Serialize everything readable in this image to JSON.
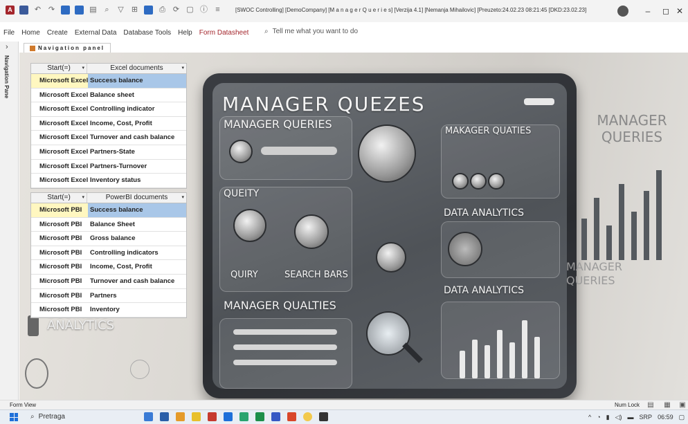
{
  "titlebar": {
    "title": "[SWOC Controlling] [DemoCompany] [M a n a g e r  Q u e r i e s] [Verzija 4.1] [Nemanja Mihailovic] [Preuzeto:24.02.23 08:21:45 [DKD:23.02.23]",
    "controls": {
      "minimize": "–",
      "restore": "◻",
      "close": "✕"
    }
  },
  "ribbon": {
    "tabs": [
      "File",
      "Home",
      "Create",
      "External Data",
      "Database Tools",
      "Help",
      "Form Datasheet"
    ],
    "active_tab": "Form Datasheet",
    "tell_me": "Tell me what you want to do"
  },
  "nav_pane": {
    "label": "Navigation Pane",
    "toggle": "›"
  },
  "document_tab": {
    "label": "Navigation panel"
  },
  "excel_list": {
    "col1_header": "Start(=)",
    "col2_header": "Excel documents",
    "rows": [
      {
        "start": "Microsoft Excel",
        "doc": "Success balance",
        "selected": true
      },
      {
        "start": "Microsoft Excel",
        "doc": "Balance sheet"
      },
      {
        "start": "Microsoft Excel",
        "doc": "Controlling indicator"
      },
      {
        "start": "Microsoft Excel",
        "doc": "Income, Cost, Profit"
      },
      {
        "start": "Microsoft Excel",
        "doc": "Turnover and cash balance"
      },
      {
        "start": "Microsoft Excel",
        "doc": "Partners-State"
      },
      {
        "start": "Microsoft Excel",
        "doc": "Partners-Turnover"
      },
      {
        "start": "Microsoft Excel",
        "doc": "Inventory status"
      }
    ]
  },
  "pbi_list": {
    "col1_header": "Start(=)",
    "col2_header": "PowerBI documents",
    "rows": [
      {
        "start": "Microsoft PBI",
        "doc": "Success balance",
        "selected": true
      },
      {
        "start": "Microsoft PBI",
        "doc": "Balance Sheet"
      },
      {
        "start": "Microsoft PBI",
        "doc": "Gross balance"
      },
      {
        "start": "Microsoft PBI",
        "doc": "Controlling indicators"
      },
      {
        "start": "Microsoft PBI",
        "doc": "Income, Cost, Profit"
      },
      {
        "start": "Microsoft PBI",
        "doc": "Turnover and cash balance"
      },
      {
        "start": "Microsoft PBI",
        "doc": "Partners"
      },
      {
        "start": "Microsoft PBI",
        "doc": "Inventory"
      }
    ]
  },
  "background_art": {
    "main_title": "MANAGER  QUEZES",
    "panel1": "MANAGER QUERIES",
    "panel2": "MAKAGER QUATIES",
    "query": "QUEITY",
    "quiry": "QUIRY",
    "search_bars": "SEARCH BARS",
    "data_analytics": "DATA ANALYTICS",
    "manager_qualties": "MANAGER QUALTIES",
    "data_analytics_2": "DATA ANALYTICS",
    "right_title": "MANAGER QUERIES",
    "right_title_2": "MANAGER QUERIES",
    "left_title": "BUSINESS ANALYTICS"
  },
  "statusbar": {
    "left": "Form View",
    "numlock": "Num Lock"
  },
  "taskbar": {
    "search": "Pretraga",
    "lang": "SRP",
    "time": "06:59"
  }
}
